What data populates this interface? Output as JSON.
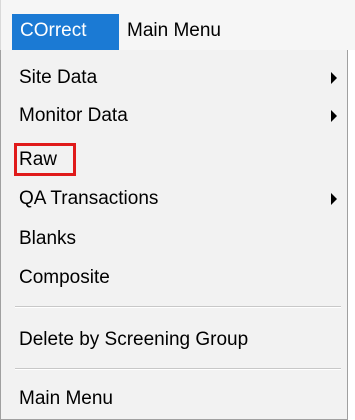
{
  "menubar": {
    "correct": "COrrect",
    "main_menu": "Main Menu"
  },
  "dropdown": {
    "items": [
      {
        "label": "Site Data",
        "has_submenu": true
      },
      {
        "label": "Monitor Data",
        "has_submenu": true
      },
      {
        "label": "Raw",
        "has_submenu": false,
        "highlighted": true
      },
      {
        "label": "QA Transactions",
        "has_submenu": true
      },
      {
        "label": "Blanks",
        "has_submenu": false
      },
      {
        "label": "Composite",
        "has_submenu": false
      },
      {
        "label": "Delete by Screening Group",
        "has_submenu": false
      },
      {
        "label": "Main Menu",
        "has_submenu": false
      }
    ]
  },
  "colors": {
    "active_menu_bg": "#1b7ad4",
    "highlight_border": "#e01b1b"
  }
}
